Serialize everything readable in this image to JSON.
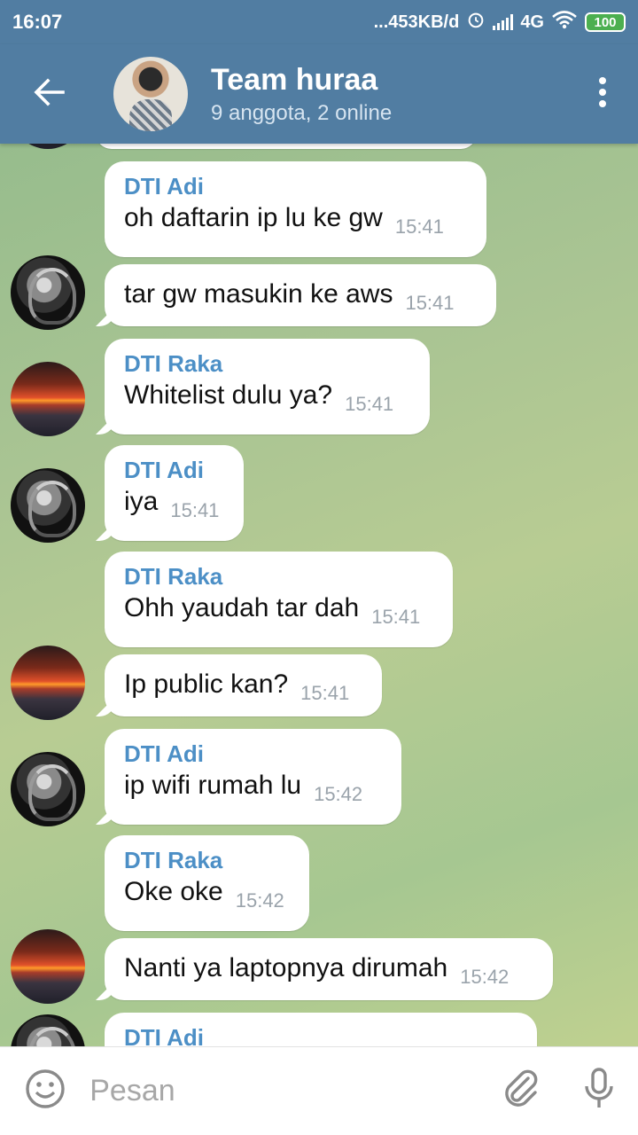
{
  "status_bar": {
    "time": "16:07",
    "network_speed": "...453KB/d",
    "network_type": "4G",
    "battery": "100"
  },
  "header": {
    "title": "Team huraa",
    "subtitle": "9 anggota, 2 online",
    "back_icon": "arrow-left-icon",
    "menu_icon": "more-vertical-icon"
  },
  "messages": [
    {
      "sender": "DTI Adi",
      "text": "oh daftarin ip lu ke gw",
      "time": "15:41"
    },
    {
      "sender": "",
      "text": "tar gw masukin ke aws",
      "time": "15:41"
    },
    {
      "sender": "DTI Raka",
      "text": "Whitelist dulu ya?",
      "time": "15:41"
    },
    {
      "sender": "DTI Adi",
      "text": "iya",
      "time": "15:41"
    },
    {
      "sender": "DTI Raka",
      "text": "Ohh yaudah tar dah",
      "time": "15:41"
    },
    {
      "sender": "",
      "text": "Ip public kan?",
      "time": "15:41"
    },
    {
      "sender": "DTI Adi",
      "text": "ip wifi rumah lu",
      "time": "15:42"
    },
    {
      "sender": "DTI Raka",
      "text": "Oke oke",
      "time": "15:42"
    },
    {
      "sender": "",
      "text": "Nanti ya laptopnya dirumah",
      "time": "15:42"
    },
    {
      "sender": "DTI Adi",
      "text": "",
      "time": ""
    }
  ],
  "input": {
    "placeholder": "Pesan",
    "emoji_icon": "smiley-icon",
    "attach_icon": "paperclip-icon",
    "mic_icon": "microphone-icon"
  },
  "colors": {
    "header_bg": "#517da2",
    "sender_name": "#4c8fc6",
    "bubble_bg": "#ffffff",
    "time_text": "#9aa3ab"
  }
}
